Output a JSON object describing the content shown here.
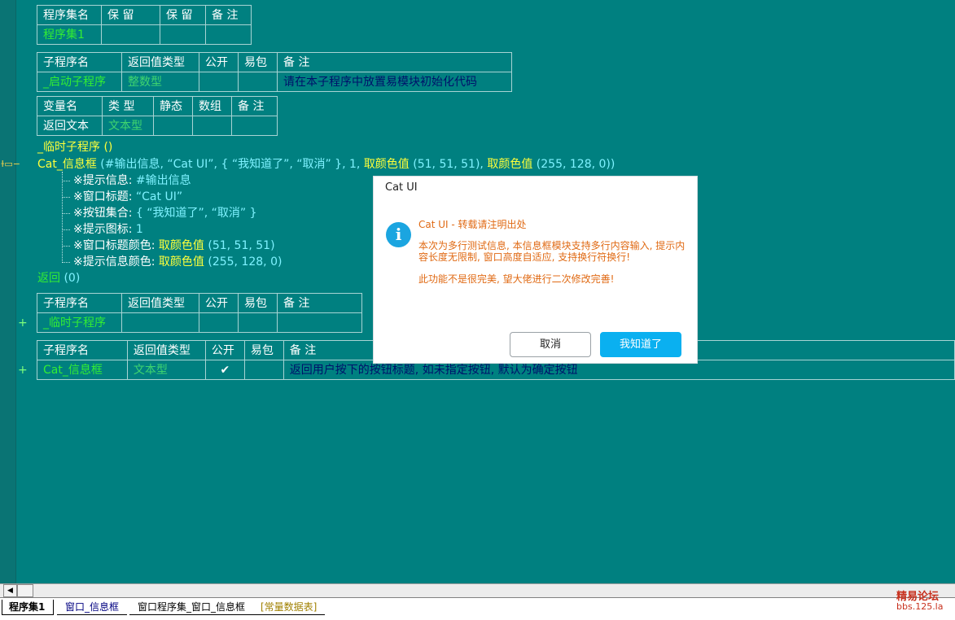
{
  "assembly_table": {
    "headers": [
      "程序集名",
      "保 留",
      "保 留",
      "备 注"
    ],
    "row": [
      "程序集1",
      "",
      "",
      ""
    ]
  },
  "sub1_table": {
    "headers": [
      "子程序名",
      "返回值类型",
      "公开",
      "易包",
      "备 注"
    ],
    "row": [
      "_启动子程序",
      "整数型",
      "",
      "",
      "请在本子程序中放置易模块初始化代码"
    ]
  },
  "var_table": {
    "headers": [
      "变量名",
      "类 型",
      "静态",
      "数组",
      "备 注"
    ],
    "row": [
      "返回文本",
      "文本型",
      "",
      "",
      ""
    ]
  },
  "code": {
    "sub_call": "_临时子程序 ()",
    "call_name": "Cat_信息框",
    "call_args_1": " (#输出信息, “Cat UI”, { “我知道了”, “取消” }, 1, ",
    "fn1": "取颜色值",
    "args_a": " (51, 51, 51), ",
    "fn2": "取颜色值",
    "args_b": " (255, 128, 0))",
    "params": [
      {
        "label": "※提示信息: ",
        "value": "#输出信息"
      },
      {
        "label": "※窗口标题: ",
        "value": "“Cat UI”"
      },
      {
        "label": "※按钮集合: ",
        "value": "{ “我知道了”, “取消” }"
      },
      {
        "label": "※提示图标: ",
        "value": "1"
      },
      {
        "label": "※窗口标题颜色: ",
        "fn": "取颜色值",
        "value": " (51, 51, 51)"
      },
      {
        "label": "※提示信息颜色: ",
        "fn": "取颜色值",
        "value": " (255, 128, 0)"
      }
    ],
    "return_kw": "返回",
    "return_val": " (0)"
  },
  "sub2_table": {
    "headers": [
      "子程序名",
      "返回值类型",
      "公开",
      "易包",
      "备 注"
    ],
    "row": [
      "_临时子程序",
      "",
      "",
      "",
      ""
    ]
  },
  "sub3_table": {
    "headers": [
      "子程序名",
      "返回值类型",
      "公开",
      "易包",
      "备 注"
    ],
    "row": [
      "Cat_信息框",
      "文本型",
      "✔",
      "",
      "返回用户按下的按钮标题, 如未指定按钮, 默认为确定按钮"
    ]
  },
  "dialog": {
    "title": "Cat UI",
    "icon": "info-icon",
    "heading": "Cat UI - 转载请注明出处",
    "body": "本次为多行测试信息, 本信息框模块支持多行内容输入, 提示内容长度无限制, 窗口高度自适应, 支持换行符换行!",
    "body2": "此功能不是很完美, 望大佬进行二次修改完善!",
    "cancel": "取消",
    "ok": "我知道了"
  },
  "tabs": [
    "程序集1",
    "窗口_信息框",
    "窗口程序集_窗口_信息框",
    "[常量数据表]"
  ],
  "watermark": {
    "line1": "精易论坛",
    "line2": "bbs.125.la"
  },
  "colors": {
    "editor_bg": "#008080",
    "keyword": "#ffff3a",
    "constant": "#7ff2ff",
    "name": "#33ee33",
    "comment": "#00106a",
    "dialog_accent": "#0ab0f0",
    "dialog_text": "#e06a14"
  }
}
